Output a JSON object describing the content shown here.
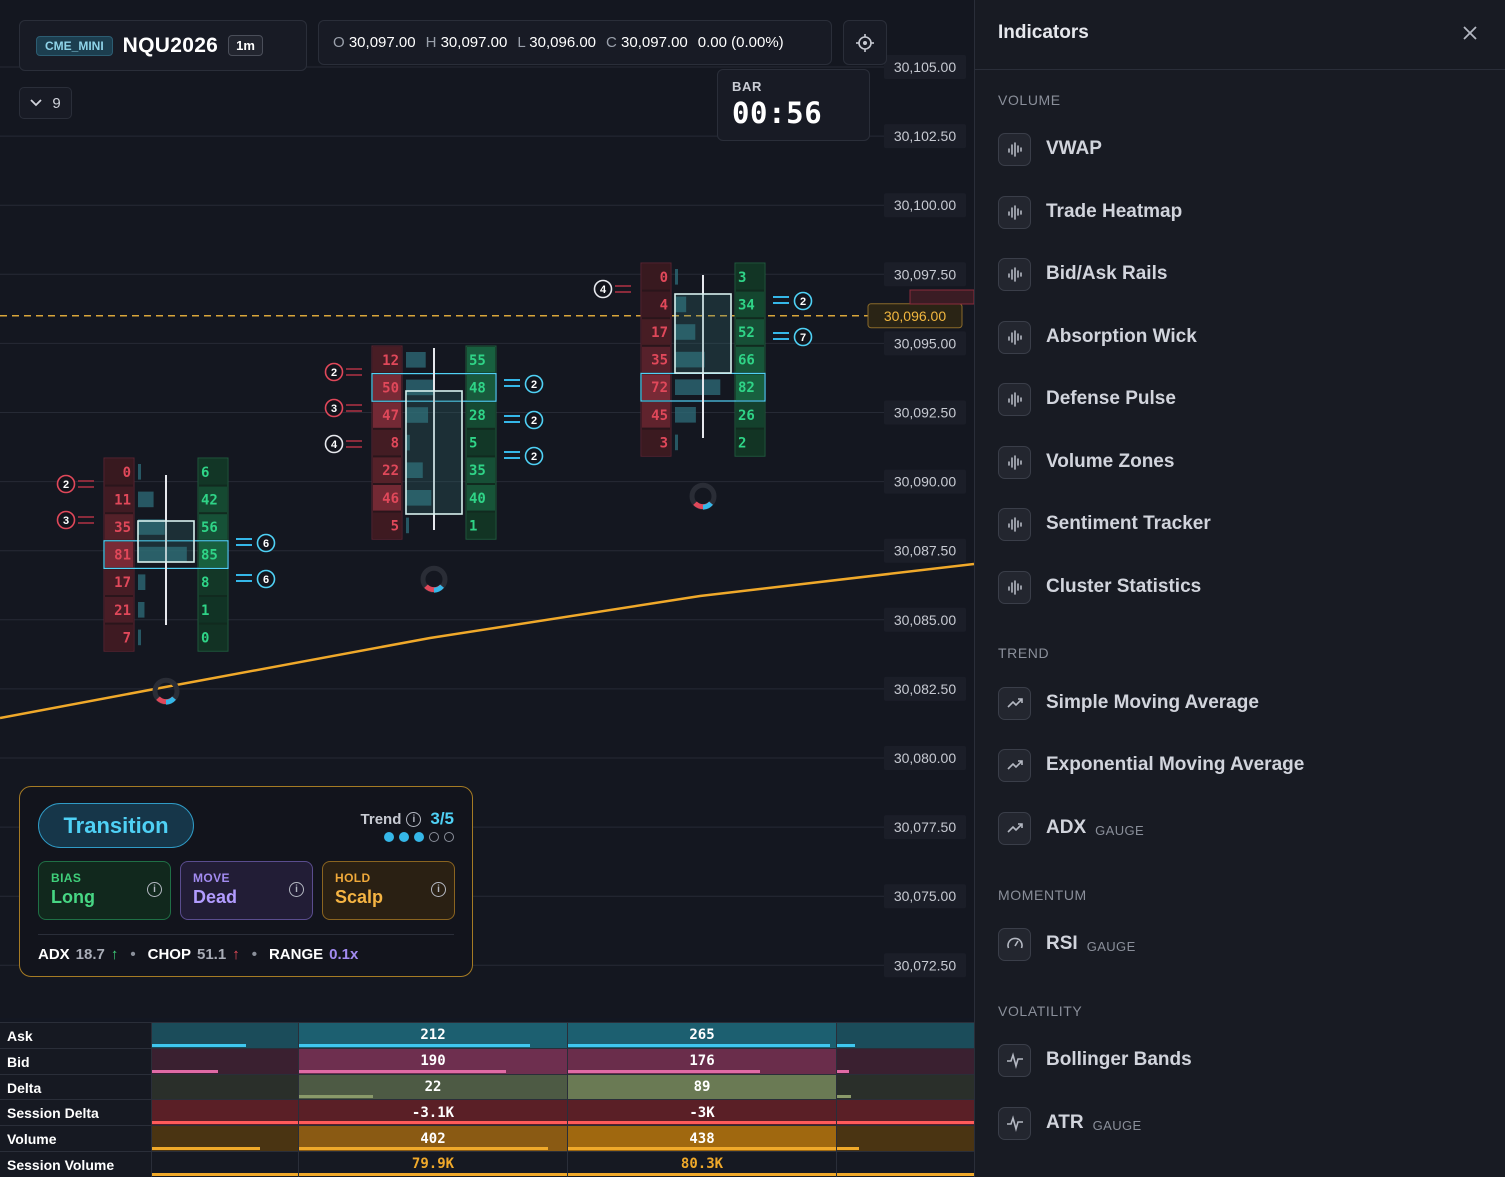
{
  "header": {
    "exchange": "CME_MINI",
    "symbol": "NQU2026",
    "timeframe": "1m",
    "ohlc": {
      "o_label": "O",
      "o": "30,097.00",
      "h_label": "H",
      "h": "30,097.00",
      "l_label": "L",
      "l": "30,096.00",
      "c_label": "C",
      "c": "30,097.00",
      "change": "0.00 (0.00%)"
    },
    "collapse_count": "9"
  },
  "bar_timer": {
    "label": "BAR",
    "value": "00:56"
  },
  "price_axis": [
    "30,105.00",
    "30,102.50",
    "30,100.00",
    "30,097.50",
    "30,095.00",
    "30,092.50",
    "30,090.00",
    "30,087.50",
    "30,085.00",
    "30,082.50",
    "30,080.00",
    "30,077.50",
    "30,075.00",
    "30,072.50"
  ],
  "current_price": "30,096.00",
  "clusters": [
    {
      "bid": [
        "0",
        "11",
        "35",
        "81",
        "17",
        "21",
        "7"
      ],
      "ask": [
        "6",
        "42",
        "56",
        "85",
        "8",
        "1",
        "0"
      ],
      "markers_left": [
        "2",
        "3"
      ],
      "markers_right": [
        "6",
        "6"
      ]
    },
    {
      "bid": [
        "12",
        "50",
        "47",
        "8",
        "22",
        "46",
        "5"
      ],
      "ask": [
        "55",
        "48",
        "28",
        "5",
        "35",
        "40",
        "1"
      ],
      "markers_left": [
        "2",
        "3",
        "4"
      ],
      "markers_right": [
        "2",
        "2",
        "2"
      ]
    },
    {
      "bid": [
        "0",
        "4",
        "17",
        "35",
        "72",
        "45",
        "3"
      ],
      "ask": [
        "3",
        "34",
        "52",
        "66",
        "82",
        "26",
        "2"
      ],
      "markers_left": [
        "4"
      ],
      "markers_right": [
        "2",
        "7"
      ]
    }
  ],
  "regime": {
    "state": "Transition",
    "trend_label": "Trend",
    "trend_value": "3/5",
    "trend_level": 3,
    "trend_max": 5,
    "bias_label": "BIAS",
    "bias_value": "Long",
    "move_label": "MOVE",
    "move_value": "Dead",
    "hold_label": "HOLD",
    "hold_value": "Scalp",
    "adx_label": "ADX",
    "adx_value": "18.7",
    "chop_label": "CHOP",
    "chop_value": "51.1",
    "range_label": "RANGE",
    "range_value": "0.1x"
  },
  "stats_table": {
    "rows": [
      {
        "label": "Ask",
        "values": [
          "212",
          "265"
        ]
      },
      {
        "label": "Bid",
        "values": [
          "190",
          "176"
        ]
      },
      {
        "label": "Delta",
        "values": [
          "22",
          "89"
        ]
      },
      {
        "label": "Session Delta",
        "values": [
          "-3.1K",
          "-3K"
        ]
      },
      {
        "label": "Volume",
        "values": [
          "402",
          "438"
        ]
      },
      {
        "label": "Session Volume",
        "values": [
          "79.9K",
          "80.3K"
        ]
      }
    ]
  },
  "sidebar": {
    "title": "Indicators",
    "sections": [
      {
        "name": "VOLUME",
        "items": [
          {
            "label": "VWAP",
            "icon": "wave-icon"
          },
          {
            "label": "Trade Heatmap",
            "icon": "wave-icon"
          },
          {
            "label": "Bid/Ask Rails",
            "icon": "wave-icon"
          },
          {
            "label": "Absorption Wick",
            "icon": "wave-icon"
          },
          {
            "label": "Defense Pulse",
            "icon": "wave-icon"
          },
          {
            "label": "Volume Zones",
            "icon": "wave-icon"
          },
          {
            "label": "Sentiment Tracker",
            "icon": "wave-icon"
          },
          {
            "label": "Cluster Statistics",
            "icon": "wave-icon"
          }
        ]
      },
      {
        "name": "TREND",
        "items": [
          {
            "label": "Simple Moving Average",
            "icon": "trend-up-icon"
          },
          {
            "label": "Exponential Moving Average",
            "icon": "trend-up-icon"
          },
          {
            "label": "ADX",
            "tag": "GAUGE",
            "icon": "trend-up-icon"
          }
        ]
      },
      {
        "name": "MOMENTUM",
        "items": [
          {
            "label": "RSI",
            "tag": "GAUGE",
            "icon": "gauge-icon"
          }
        ]
      },
      {
        "name": "VOLATILITY",
        "items": [
          {
            "label": "Bollinger Bands",
            "icon": "pulse-icon"
          },
          {
            "label": "ATR",
            "tag": "GAUGE",
            "icon": "pulse-icon"
          }
        ]
      }
    ]
  },
  "colors": {
    "accent": "#4fd1f5",
    "bid": "#e0485a",
    "ask": "#27c17a",
    "vwap": "#f0a92a",
    "price_line": "#d9a63a"
  }
}
